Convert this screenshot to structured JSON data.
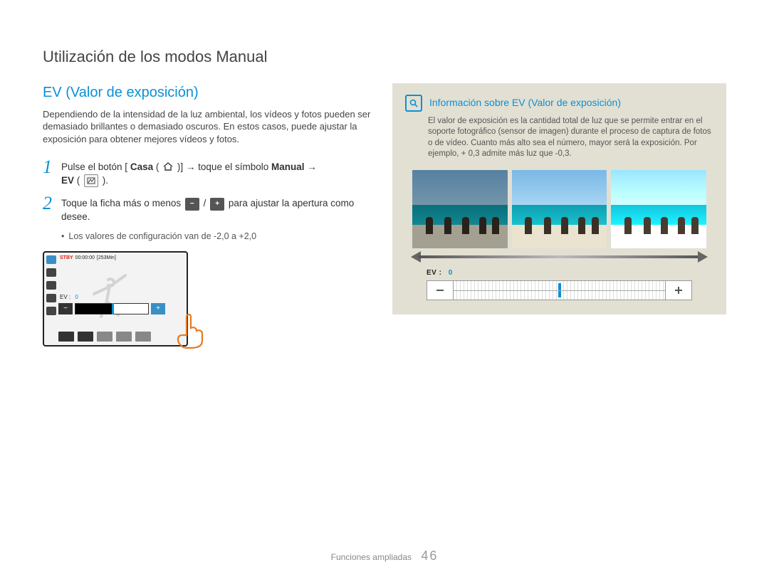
{
  "page_title": "Utilización de los modos Manual",
  "footer": {
    "section": "Funciones ampliadas",
    "page_number": "46"
  },
  "left": {
    "section_title": "EV (Valor de exposición)",
    "intro": "Dependiendo de la intensidad de la luz ambiental, los vídeos y fotos pueden ser demasiado brillantes o demasiado oscuros. En estos casos, puede ajustar la exposición para obtener mejores vídeos y fotos.",
    "steps": [
      {
        "n": "1",
        "pre": "Pulse el botón [",
        "bold1": "Casa",
        "mid1": " (",
        "mid2": ")] → toque el símbolo ",
        "bold2": "Manual",
        "mid3": " → ",
        "bold3": "EV",
        "tail": " ( )."
      },
      {
        "n": "2",
        "pre": "Toque la ficha más o menos ",
        "mid": " / ",
        "post": " para ajustar la apertura como desee."
      }
    ],
    "bullet": "Los valores de configuración van de -2,0 a +2,0",
    "lcd": {
      "stby": "STBY",
      "time": "00:00:00",
      "remaining": "[253Min]",
      "ev_label": "EV :",
      "ev_value": "0"
    }
  },
  "right": {
    "info_title": "Información sobre EV (Valor de exposición)",
    "info_body": "El valor de exposición es la cantidad total de luz que se permite entrar en el soporte fotográfico (sensor de imagen) durante el proceso de captura de fotos o de vídeo. Cuanto más alto sea el número, mayor será la exposición. Por ejemplo, + 0,3 admite más luz que -0,3.",
    "ev_label": "EV :",
    "ev_value": "0",
    "minus_glyph": "−",
    "plus_glyph": "+"
  }
}
